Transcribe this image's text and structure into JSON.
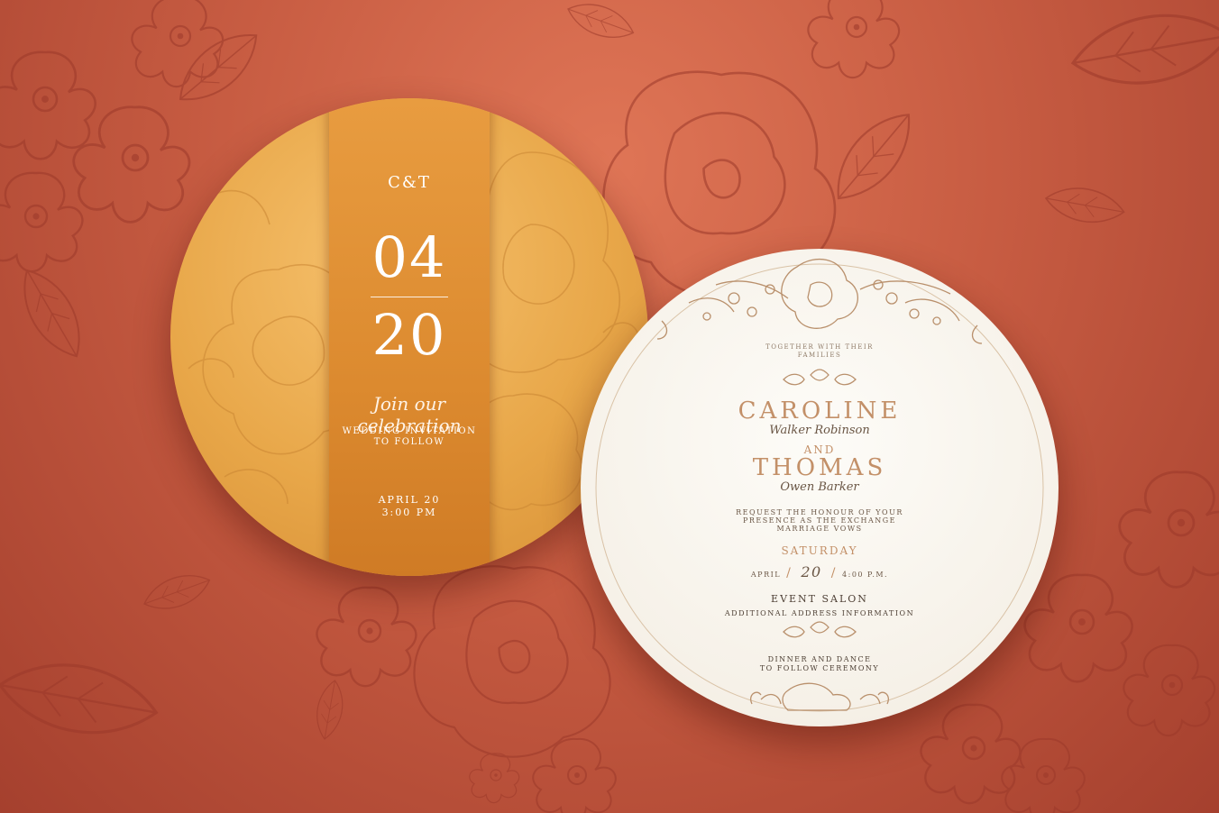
{
  "colors": {
    "background": "#c75c42",
    "floral_line": "#9c3a2a",
    "gold": "#e8a749",
    "gold_band": "#dc8a2f",
    "cream": "#f6f1e8",
    "accent_text": "#c39068",
    "dark_text": "#4e4035"
  },
  "gold_card": {
    "monogram": "C&T",
    "month": "04",
    "day": "20",
    "script_line": "Join our celebration",
    "invitation_line1": "WEDDING INVITATION",
    "invitation_line2": "TO FOLLOW",
    "date": "APRIL 20",
    "time": "3:00 PM"
  },
  "white_card": {
    "together_line1": "TOGETHER WITH THEIR",
    "together_line2": "FAMILIES",
    "bride_name": "CAROLINE",
    "bride_surname": "Walker Robinson",
    "conjunction": "AND",
    "groom_name": "THOMAS",
    "groom_surname": "Owen Barker",
    "request_line1": "REQUEST THE HONOUR OF YOUR",
    "request_line2": "PRESENCE AS THE EXCHANGE",
    "request_line3": "MARRIAGE VOWS",
    "weekday": "SATURDAY",
    "month": "APRIL",
    "day": "20",
    "time": "4:00 P.M.",
    "venue": "EVENT SALON",
    "address": "ADDITIONAL ADDRESS INFORMATION",
    "dinner_line1": "DINNER AND DANCE",
    "dinner_line2": "TO FOLLOW CEREMONY"
  },
  "icons": [
    "floral-background-pattern",
    "peony-illustration",
    "leaf-sprig-ornament"
  ]
}
